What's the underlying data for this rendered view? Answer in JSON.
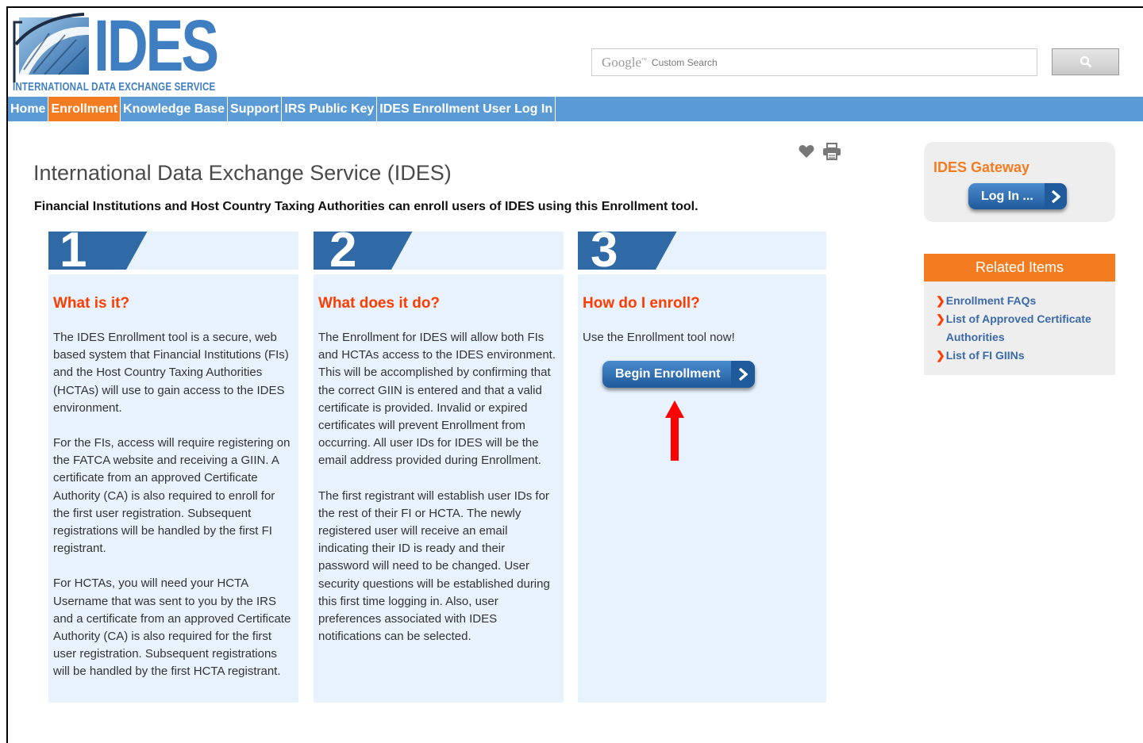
{
  "header": {
    "logo_text": "IDES",
    "logo_subtitle": "INTERNATIONAL DATA EXCHANGE SERVICE",
    "search": {
      "brand": "Google",
      "placeholder": "Custom Search"
    }
  },
  "nav": {
    "items": [
      {
        "label": "Home"
      },
      {
        "label": "Enrollment",
        "active": true
      },
      {
        "label": "Knowledge Base"
      },
      {
        "label": "Support"
      },
      {
        "label": "IRS Public Key"
      },
      {
        "label": "IDES Enrollment User Log In"
      }
    ]
  },
  "main": {
    "title": "International Data Exchange Service (IDES)",
    "lead": "Financial Institutions and Host Country Taxing Authorities can enroll users of IDES using this Enrollment tool.",
    "columns": [
      {
        "number": "1",
        "heading": "What is it?",
        "paragraphs": [
          "The IDES Enrollment tool is a secure, web based system that Financial Institutions (FIs) and the Host Country Taxing Authorities (HCTAs) will use to gain access to the IDES environment.",
          "For the FIs, access will require registering on the FATCA website and receiving a GIIN. A certificate from an approved Certificate Authority (CA) is also required to enroll for the first user registration. Subsequent registrations will be handled by the first FI registrant.",
          "For HCTAs, you will need your HCTA Username that was sent to you by the IRS and a certificate from an approved Certificate Authority (CA) is also required for the first user registration. Subsequent registrations will be handled by the first HCTA registrant."
        ]
      },
      {
        "number": "2",
        "heading": "What does it do?",
        "paragraphs": [
          "The Enrollment for IDES will allow both FIs and HCTAs access to the IDES environment. This will be accomplished by confirming that the correct GIIN is entered and that a valid certificate is provided. Invalid or expired certificates will prevent Enrollment from occurring. All user IDs for IDES will be the email address provided during Enrollment.",
          "The first registrant will establish user IDs for the rest of their FI or HCTA. The newly registered user will receive an email indicating their ID is ready and their password will need to be changed. User security questions will be established during this first time logging in. Also, user preferences associated with IDES notifications can be selected."
        ]
      },
      {
        "number": "3",
        "heading": "How do I enroll?",
        "paragraphs": [
          "Use the Enrollment tool now!"
        ],
        "button": "Begin Enrollment"
      }
    ]
  },
  "sidebar": {
    "gateway": {
      "title": "IDES Gateway",
      "button": "Log In ..."
    },
    "related": {
      "title": "Related Items",
      "links": [
        "Enrollment FAQs",
        "List of Approved Certificate Authorities",
        "List of FI GIINs"
      ]
    }
  },
  "colors": {
    "nav_blue": "#5b9bd5",
    "accent_orange": "#f47c20",
    "heading_red": "#ff3c00",
    "panel_blue": "#e7f2fc",
    "annotation_arrow": "#ff0000"
  }
}
